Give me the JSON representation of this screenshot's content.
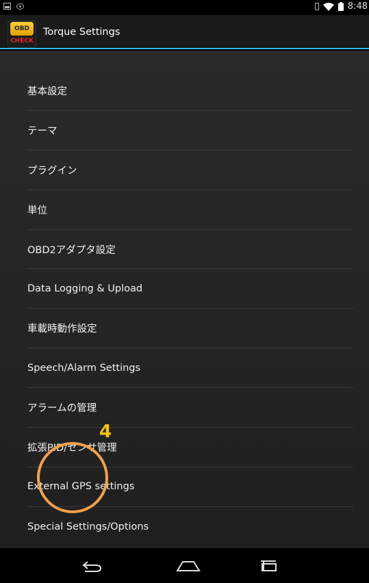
{
  "status_bar": {
    "time": "8:48"
  },
  "action_bar": {
    "title": "Torque Settings",
    "icon_top": "OBD",
    "icon_bottom": "CHECK"
  },
  "settings_items": [
    "基本設定",
    "テーマ",
    "プラグイン",
    "単位",
    "OBD2アダプタ設定",
    "Data Logging & Upload",
    "車載時動作設定",
    "Speech/Alarm Settings",
    "アラームの管理",
    "拡張PID/センサ管理",
    "External GPS settings",
    "Special Settings/Options"
  ],
  "annotation": {
    "number": "4",
    "color": "#f4a04a"
  },
  "colors": {
    "accent": "#33b5e5",
    "text": "#f2f2f2"
  }
}
